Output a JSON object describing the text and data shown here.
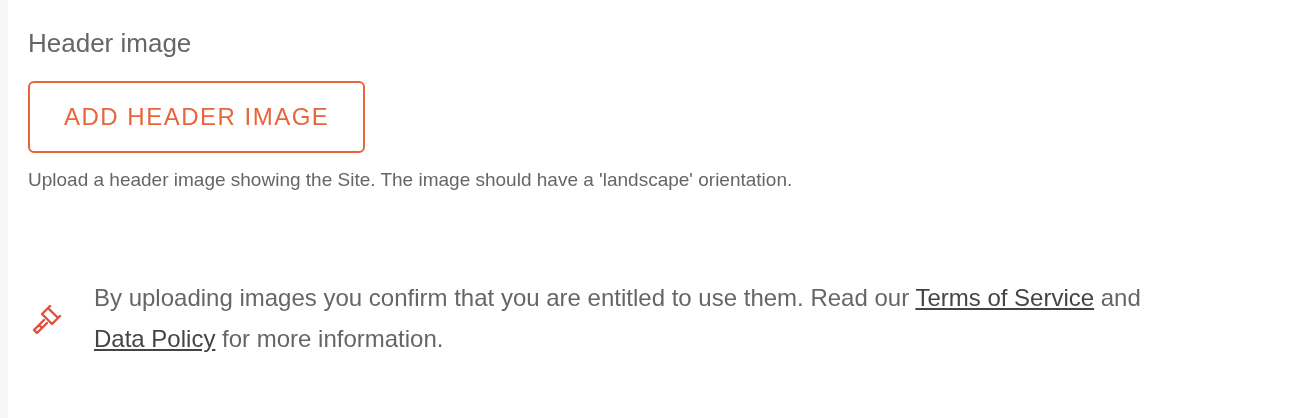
{
  "section": {
    "title": "Header image",
    "button": {
      "label": "ADD HEADER IMAGE"
    },
    "helper_text": "Upload a header image showing the Site. The image should have a 'landscape' orientation."
  },
  "notice": {
    "parts": [
      {
        "kind": "text",
        "text": "By uploading images you confirm that you are entitled to use them. Read our "
      },
      {
        "kind": "link",
        "text": "Terms of Service"
      },
      {
        "kind": "text",
        "text": " and "
      },
      {
        "kind": "link",
        "text": "Data Policy"
      },
      {
        "kind": "text",
        "text": " for more information."
      }
    ]
  }
}
